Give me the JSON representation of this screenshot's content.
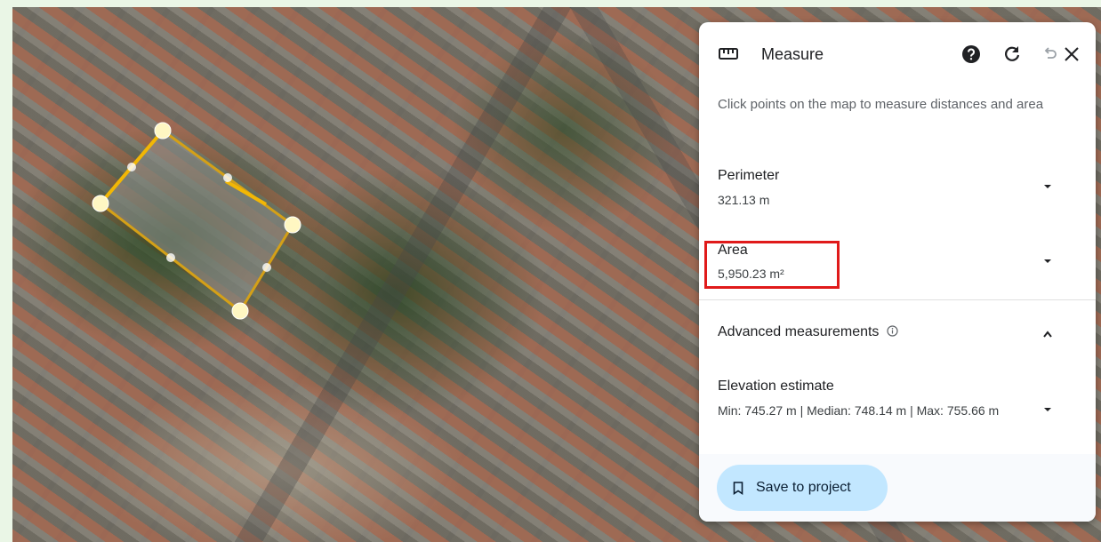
{
  "panel": {
    "title": "Measure",
    "hint": "Click points on the map to measure distances and area",
    "perimeter": {
      "label": "Perimeter",
      "value": "321.13 m"
    },
    "area": {
      "label": "Area",
      "value": "5,950.23 m²"
    },
    "advanced": {
      "label": "Advanced measurements",
      "info_icon": "info-icon"
    },
    "elevation": {
      "label": "Elevation estimate",
      "value": "Min: 745.27 m | Median: 748.14 m | Max: 755.66 m"
    },
    "save_label": "Save to project"
  },
  "icons": {
    "ruler": "ruler-icon",
    "help": "help-icon",
    "refresh": "refresh-icon",
    "undo": "undo-icon",
    "close": "close-icon",
    "caret": "caret-down-icon",
    "bookmark": "bookmark-icon"
  },
  "colors": {
    "accent_button": "#c2e7ff",
    "highlight": "#e01a1a",
    "polygon_stroke": "#d4a017",
    "vertex": "#fff7c2"
  }
}
